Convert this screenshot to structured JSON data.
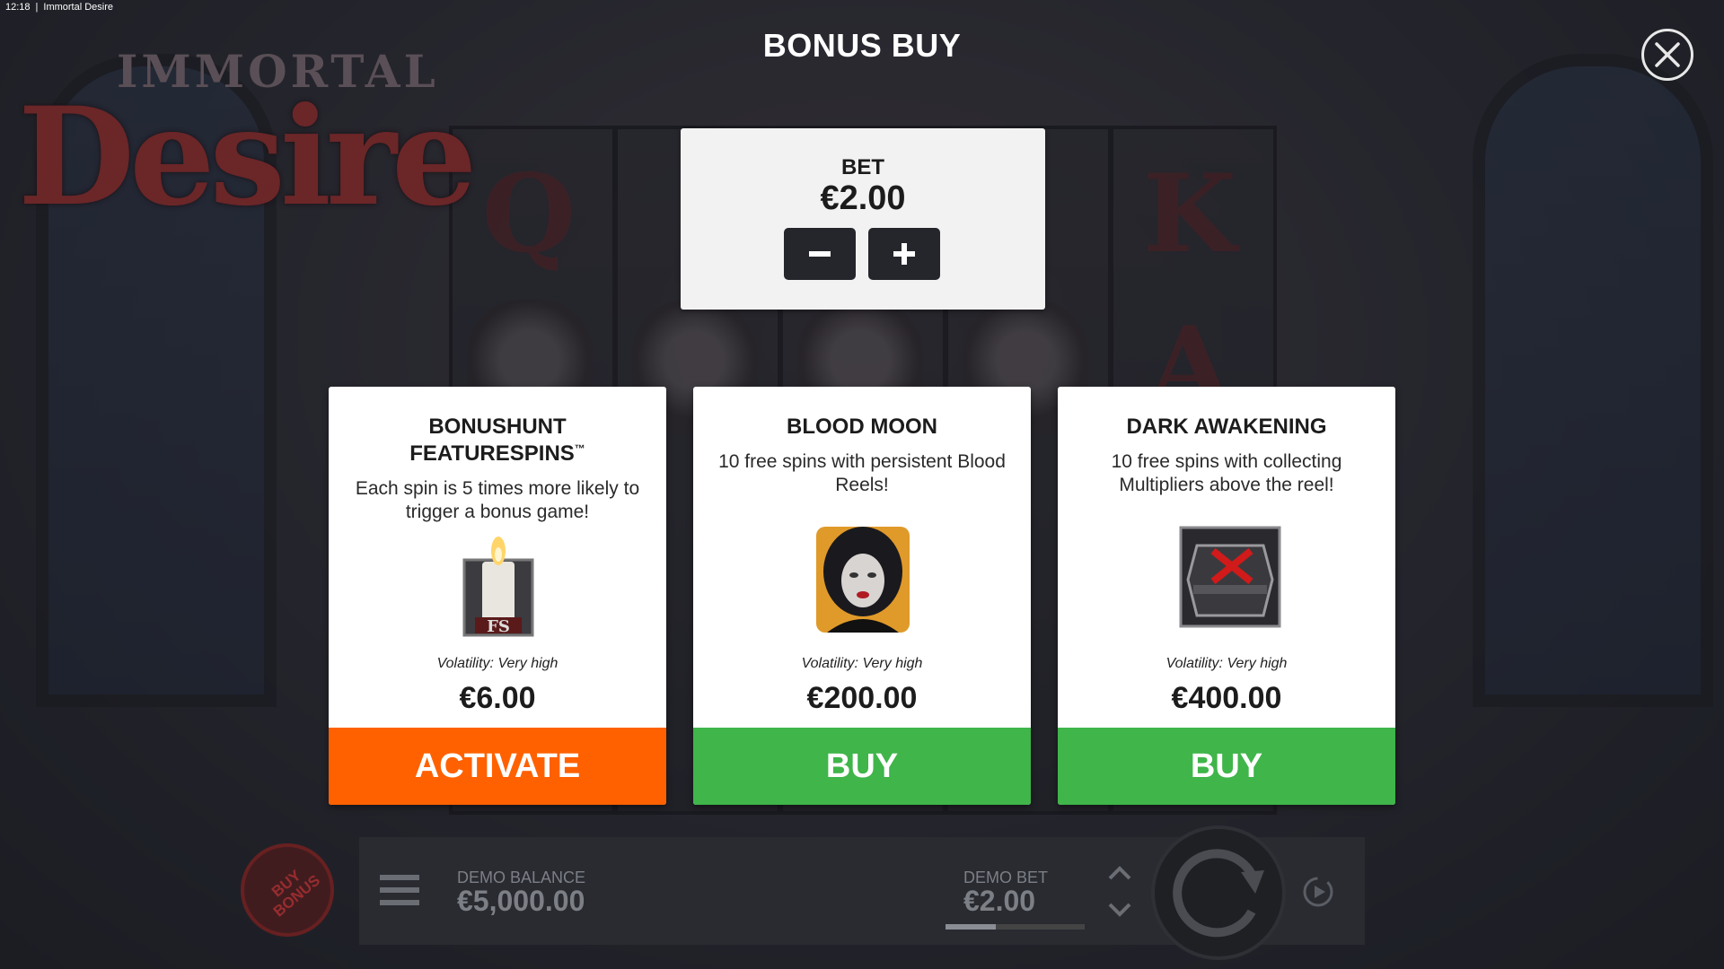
{
  "status_bar": {
    "time": "12:18",
    "separator": "|",
    "window_title": "Immortal Desire"
  },
  "game_logo": {
    "line1": "IMMORTAL",
    "line2": "Desire"
  },
  "background_symbols": [
    "Q",
    "K",
    "A"
  ],
  "bonus_buy": {
    "title": "BONUS BUY",
    "bet": {
      "label": "BET",
      "value": "€2.00"
    },
    "cards": [
      {
        "title_line1": "BONUSHUNT",
        "title_line2": "FEATURESPINS",
        "trademark": "™",
        "description": "Each spin is 5 times more likely to trigger a bonus game!",
        "icon": "candle-fs-icon",
        "volatility": "Volatility: Very high",
        "price": "€6.00",
        "button": "ACTIVATE",
        "button_color": "#ff6100"
      },
      {
        "title_line1": "BLOOD MOON",
        "description": "10 free spins with persistent Blood Reels!",
        "icon": "vampire-woman-icon",
        "volatility": "Volatility: Very high",
        "price": "€200.00",
        "button": "BUY",
        "button_color": "#3fb54a"
      },
      {
        "title_line1": "DARK AWAKENING",
        "description": "10 free spins with collecting Multipliers above the reel!",
        "icon": "coffin-icon",
        "volatility": "Volatility: Very high",
        "price": "€400.00",
        "button": "BUY",
        "button_color": "#3fb54a"
      }
    ]
  },
  "hud": {
    "buy_bonus": "BUY BONUS",
    "balance_label": "DEMO BALANCE",
    "balance_value": "€5,000.00",
    "bet_label": "DEMO BET",
    "bet_value": "€2.00"
  }
}
